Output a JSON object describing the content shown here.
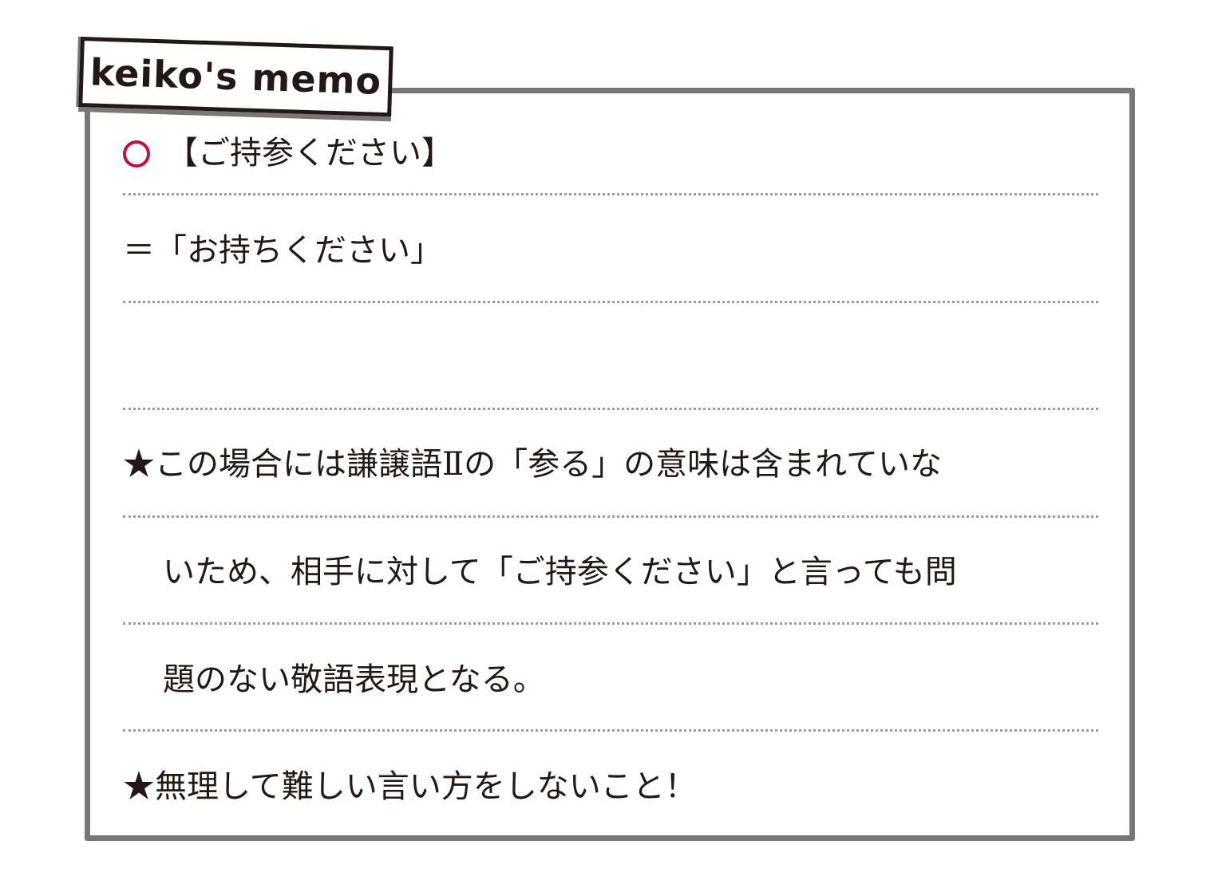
{
  "memo": {
    "label": "keiko's memo",
    "accent_color": "#c30d45",
    "frame_color": "#777777",
    "lines": [
      {
        "text": "【ご持参ください】",
        "mark": "circle-icon"
      },
      {
        "text": "＝「お持ちください」"
      },
      {
        "text": ""
      },
      {
        "text": "★この場合には謙譲語Ⅱの「参る」の意味は含まれていな"
      },
      {
        "text": "いため、相手に対して「ご持参ください」と言っても問"
      },
      {
        "text": "題のない敬語表現となる。"
      },
      {
        "text": "★無理して難しい言い方をしないこと！"
      }
    ]
  }
}
